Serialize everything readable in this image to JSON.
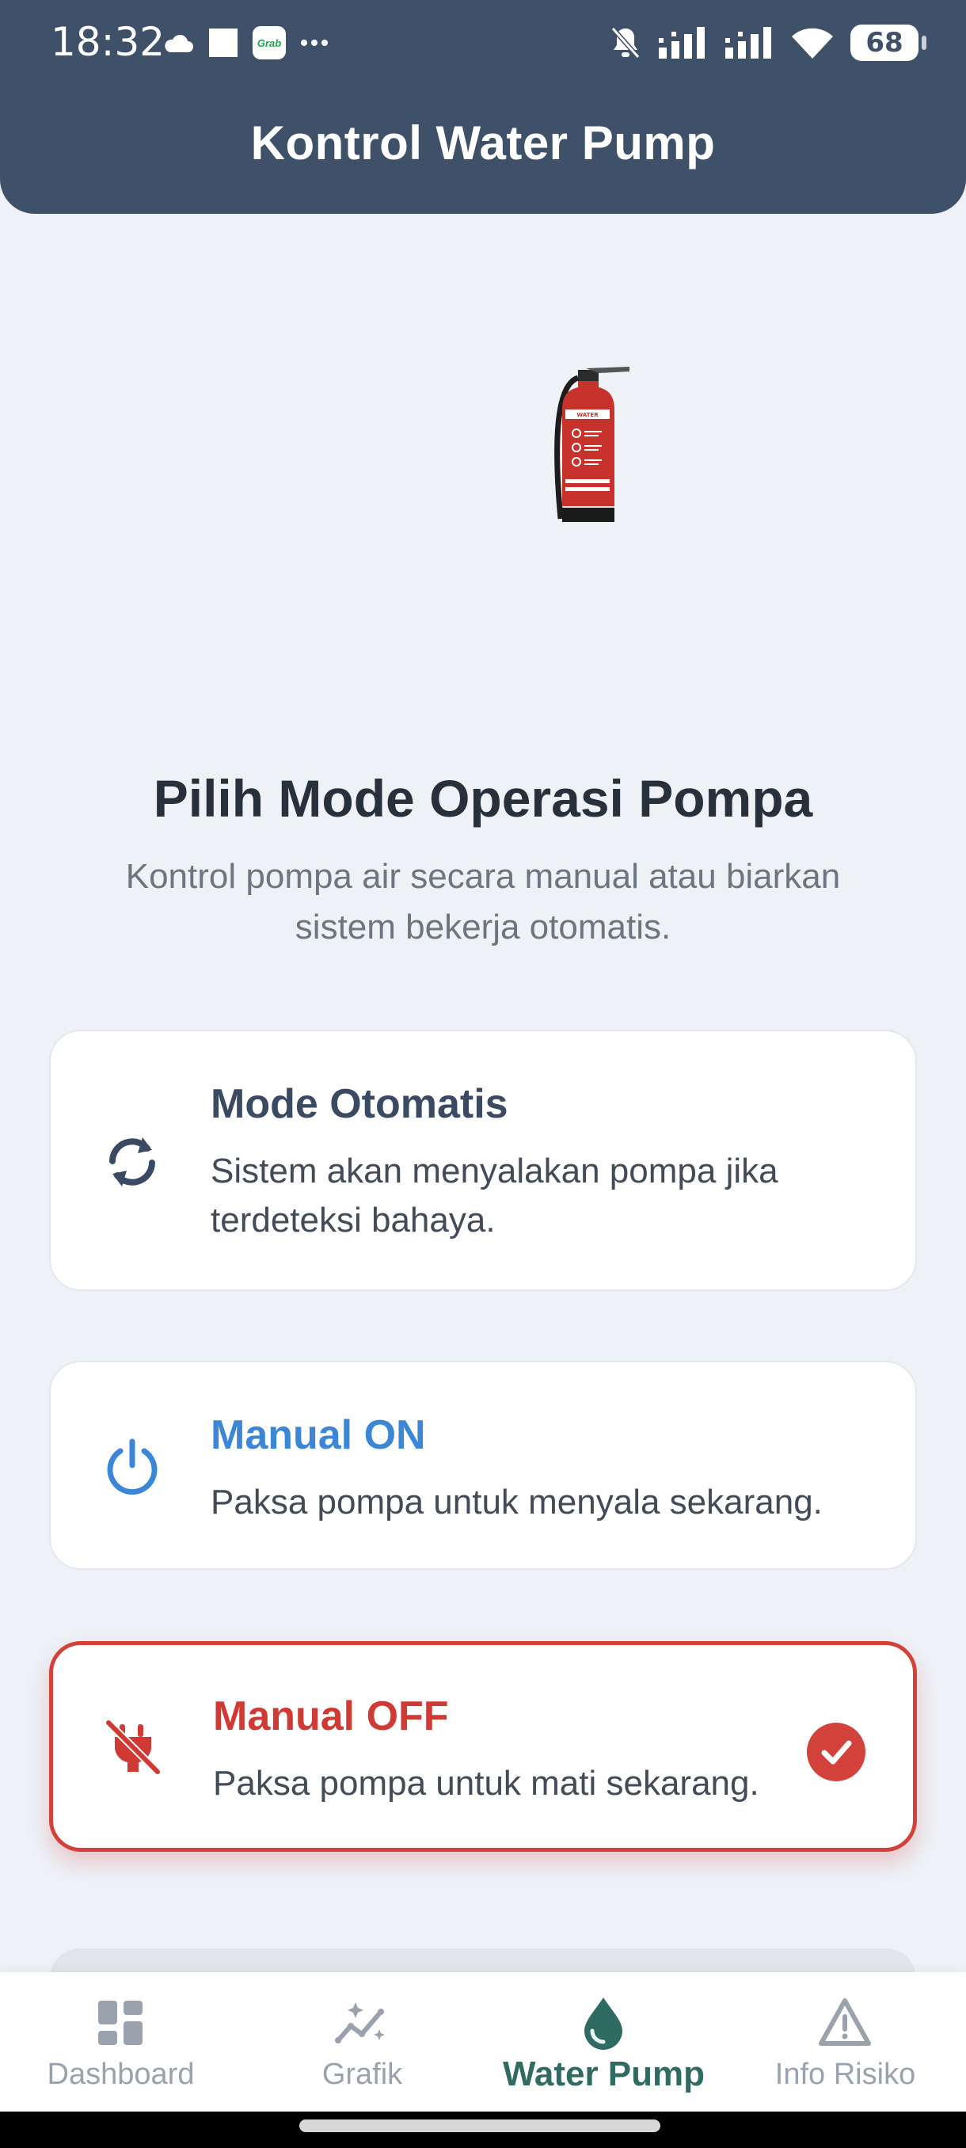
{
  "status_bar": {
    "time": "18:32",
    "left_icons": [
      "cloud-icon",
      "square-notification-icon",
      "grab-app-icon",
      "more-dots-icon"
    ],
    "right_icons": [
      "mute-icon",
      "signal-icon",
      "signal-icon",
      "wifi-icon"
    ],
    "battery": "68",
    "grab_label": "Grab"
  },
  "header": {
    "title": "Kontrol Water Pump",
    "color": "#3f5169"
  },
  "hero": {
    "icon": "fire-extinguisher-icon",
    "extinguisher_label": "WATER"
  },
  "intro": {
    "title": "Pilih Mode Operasi Pompa",
    "subtitle": "Kontrol pompa air secara manual atau biarkan sistem bekerja otomatis."
  },
  "modes": [
    {
      "icon": "sync-icon",
      "title": "Mode Otomatis",
      "description": "Sistem akan menyalakan pompa jika terdeteksi bahaya.",
      "color": "#3a4a62",
      "selected": false
    },
    {
      "icon": "power-icon",
      "title": "Manual ON",
      "description": "Paksa pompa untuk menyala sekarang.",
      "color": "#3d86d6",
      "selected": false
    },
    {
      "icon": "plug-off-icon",
      "title": "Manual OFF",
      "description": "Paksa pompa untuk mati sekarang.",
      "color": "#cf3b34",
      "selected": true
    }
  ],
  "bottom_nav": [
    {
      "icon": "dashboard-icon",
      "label": "Dashboard",
      "active": false
    },
    {
      "icon": "chart-sparkle-icon",
      "label": "Grafik",
      "active": false
    },
    {
      "icon": "water-drop-icon",
      "label": "Water Pump",
      "active": true
    },
    {
      "icon": "warning-icon",
      "label": "Info Risiko",
      "active": false
    }
  ],
  "colors": {
    "active_nav": "#2f6b63",
    "inactive_nav": "#9aa3ad",
    "selected_border": "#d2423b"
  }
}
